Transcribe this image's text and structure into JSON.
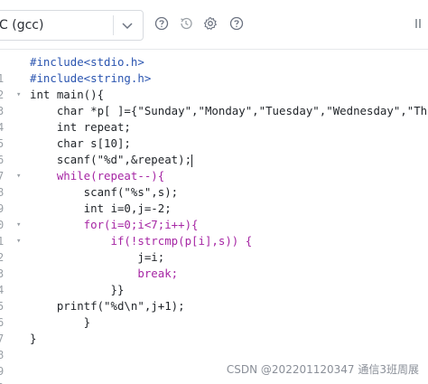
{
  "toolbar": {
    "language": "C (gcc)",
    "icons": [
      "help-circle-icon",
      "history-icon",
      "settings-gear-icon",
      "help-circle-icon",
      "more-icon"
    ]
  },
  "editor": {
    "line_numbers": [
      "1",
      "2",
      "3",
      "4",
      "5",
      "6",
      "7",
      "8",
      "9",
      "0",
      "1",
      "2",
      "3",
      "4",
      "5",
      "6",
      "7",
      "8",
      "9",
      "0"
    ],
    "lines": [
      "#include<stdio.h>",
      "#include<string.h>",
      "int main(){",
      "    char *p[ ]={\"Sunday\",\"Monday\",\"Tuesday\",\"Wednesday\",\"Thurs",
      "    int repeat;",
      "    char s[10];",
      "    scanf(\"%d\",&repeat);",
      "    while(repeat--){",
      "        scanf(\"%s\",s);",
      "        int i=0,j=-2;",
      "        for(i=0;i<7;i++){",
      "            if(!strcmp(p[i],s)) {",
      "                j=i;",
      "                break;",
      "            }}",
      "    printf(\"%d\\n\",j+1);",
      "        }",
      "}",
      "",
      ""
    ]
  },
  "watermark": "CSDN @202201120347  通信3班周展"
}
